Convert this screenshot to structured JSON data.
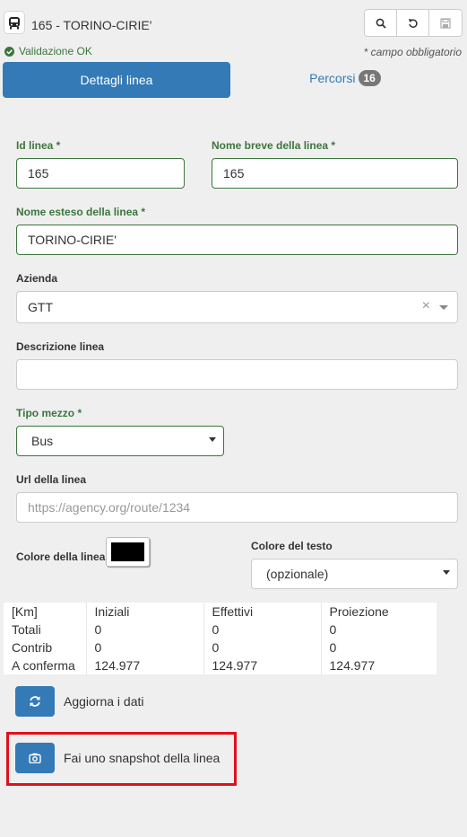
{
  "header": {
    "title": "165 - TORINO-CIRIE'",
    "validation": "Validazione OK",
    "required_note": "* campo obbligatorio"
  },
  "tabs": [
    {
      "label": "Dettagli linea"
    },
    {
      "label": "Percorsi",
      "badge": "16"
    }
  ],
  "form": {
    "id_linea": {
      "label": "Id linea *",
      "value": "165"
    },
    "nome_breve": {
      "label": "Nome breve della linea *",
      "value": "165"
    },
    "nome_esteso": {
      "label": "Nome esteso della linea *",
      "value": "TORINO-CIRIE'"
    },
    "azienda": {
      "label": "Azienda",
      "value": "GTT",
      "clear": "×"
    },
    "descrizione": {
      "label": "Descrizione linea",
      "value": ""
    },
    "tipo_mezzo": {
      "label": "Tipo mezzo *",
      "value": "Bus"
    },
    "url": {
      "label": "Url della linea",
      "placeholder": "https://agency.org/route/1234"
    },
    "colore_linea": {
      "label": "Colore della linea",
      "color": "#000000"
    },
    "colore_testo": {
      "label": "Colore del testo",
      "value": "(opzionale)"
    }
  },
  "stats": {
    "headers": [
      "[Km]",
      "Iniziali",
      "Effettivi",
      "Proiezione"
    ],
    "rows": [
      [
        "Totali",
        "0",
        "0",
        "0"
      ],
      [
        "Contrib",
        "0",
        "0",
        "0"
      ],
      [
        "A conferma",
        "124.977",
        "124.977",
        "124.977"
      ]
    ]
  },
  "actions": {
    "refresh_label": "Aggiorna i dati",
    "snapshot_label": "Fai uno snapshot della linea"
  },
  "colors": {
    "primary": "#337ab7",
    "success": "#3c763d",
    "highlight": "#e0101b",
    "badge": "#777777"
  }
}
